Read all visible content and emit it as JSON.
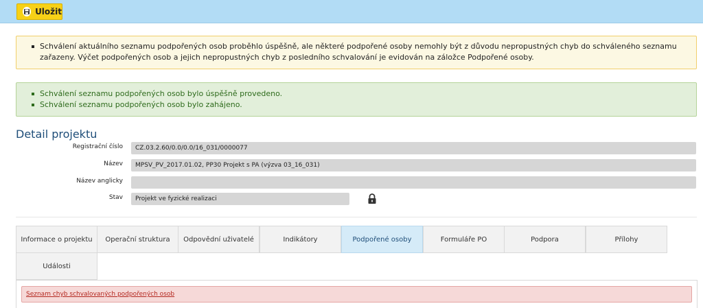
{
  "toolbar": {
    "save_label": "Uložit"
  },
  "alerts": {
    "warning": [
      "Schválení aktuálního seznamu podpořených osob proběhlo úspěšně, ale některé podpořené osoby nemohly být z důvodu nepropustných chyb do schváleného seznamu zařazeny. Výčet podpořených osob a jejich nepropustných chyb z posledního schvalování je evidován na záložce Podpořené osoby."
    ],
    "success": [
      "Schválení seznamu podpořených osob bylo úspěšně provedeno.",
      "Schválení seznamu podpořených osob bylo zahájeno."
    ]
  },
  "detail": {
    "title": "Detail projektu",
    "fields": [
      {
        "label": "Registrační číslo",
        "value": "CZ.03.2.60/0.0/0.0/16_031/0000077"
      },
      {
        "label": "Název",
        "value": "MPSV_PV_2017.01.02, PP30 Projekt s PA (výzva 03_16_031)"
      },
      {
        "label": "Název anglicky",
        "value": ""
      },
      {
        "label": "Stav",
        "value": "Projekt ve fyzické realizaci"
      }
    ],
    "lock_icon": "lock-icon"
  },
  "tabs": [
    {
      "label": "Informace o projektu"
    },
    {
      "label": "Operační struktura"
    },
    {
      "label": "Odpovědní uživatelé"
    },
    {
      "label": "Indikátory"
    },
    {
      "label": "Podpořené osoby",
      "active": true
    },
    {
      "label": "Formuláře PO"
    },
    {
      "label": "Podpora"
    },
    {
      "label": "Přílohy"
    },
    {
      "label": "Události"
    }
  ],
  "content": {
    "error_link": "Seznam chyb schvalovaných podpořených osob"
  },
  "colors": {
    "topbar": "#b2dcf5",
    "save_button": "#f7d117",
    "warning_bg": "#fcf8e3",
    "success_bg": "#e2efda",
    "success_text": "#2e6b1c",
    "active_tab": "#d5ebf8",
    "error_bg": "#f6d9d8",
    "error_text": "#b3261e"
  }
}
